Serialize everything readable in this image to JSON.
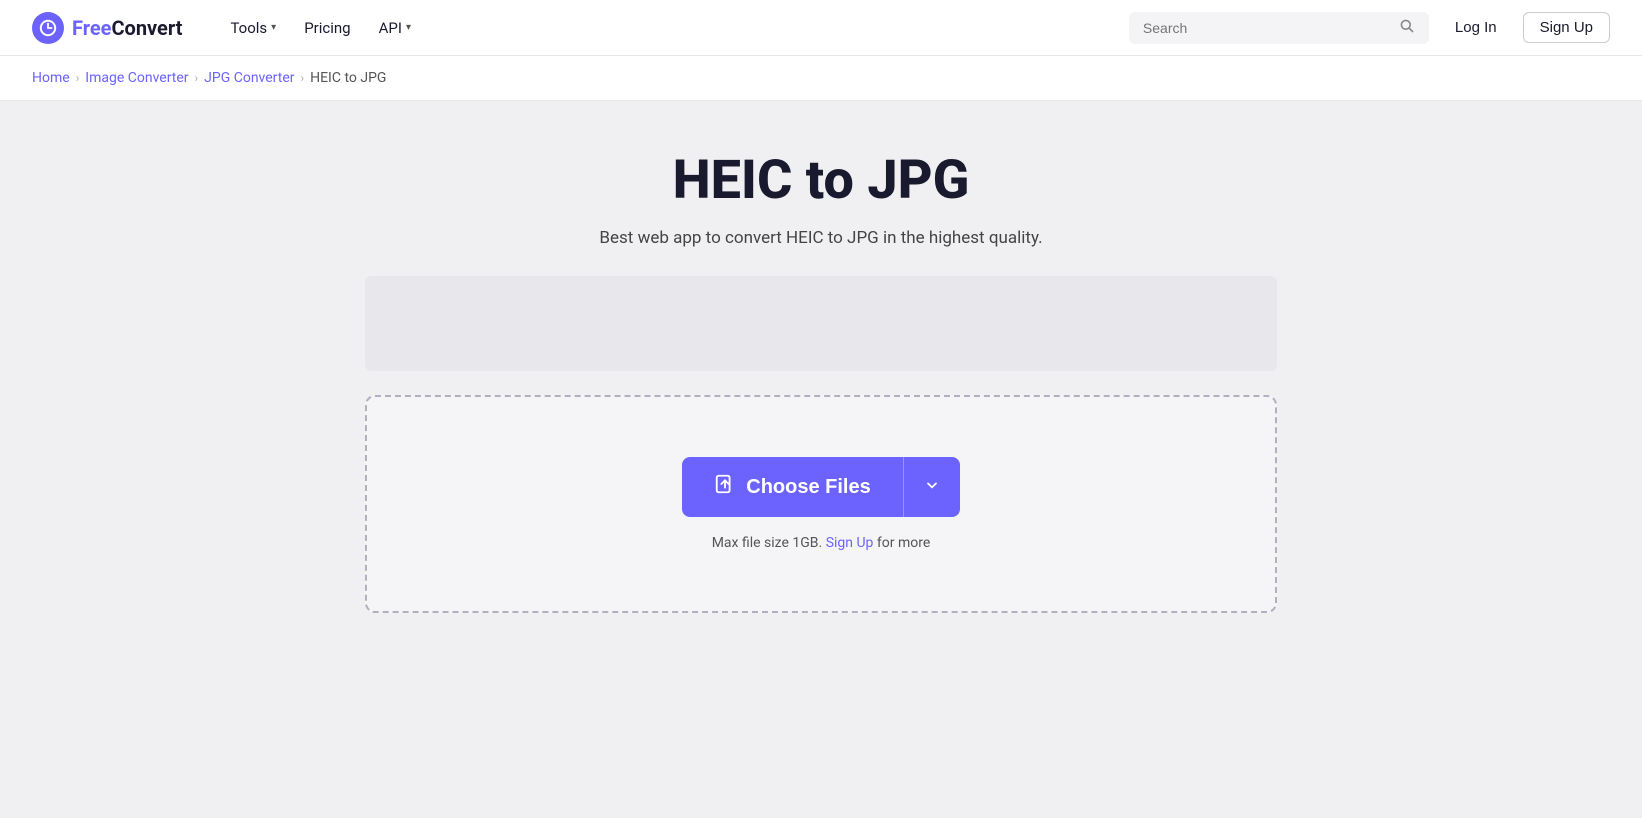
{
  "brand": {
    "free": "Free",
    "convert": "Convert",
    "logo_symbol": "⟳"
  },
  "nav": {
    "tools_label": "Tools",
    "pricing_label": "Pricing",
    "api_label": "API",
    "login_label": "Log In",
    "signup_label": "Sign Up",
    "search_placeholder": "Search"
  },
  "breadcrumb": {
    "home": "Home",
    "image_converter": "Image Converter",
    "jpg_converter": "JPG Converter",
    "current": "HEIC to JPG"
  },
  "page": {
    "title": "HEIC to JPG",
    "subtitle": "Best web app to convert HEIC to JPG in the highest quality.",
    "choose_files_label": "Choose Files",
    "file_limit_text": "Max file size 1GB.",
    "signup_link": "Sign Up",
    "file_limit_suffix": "for more"
  }
}
